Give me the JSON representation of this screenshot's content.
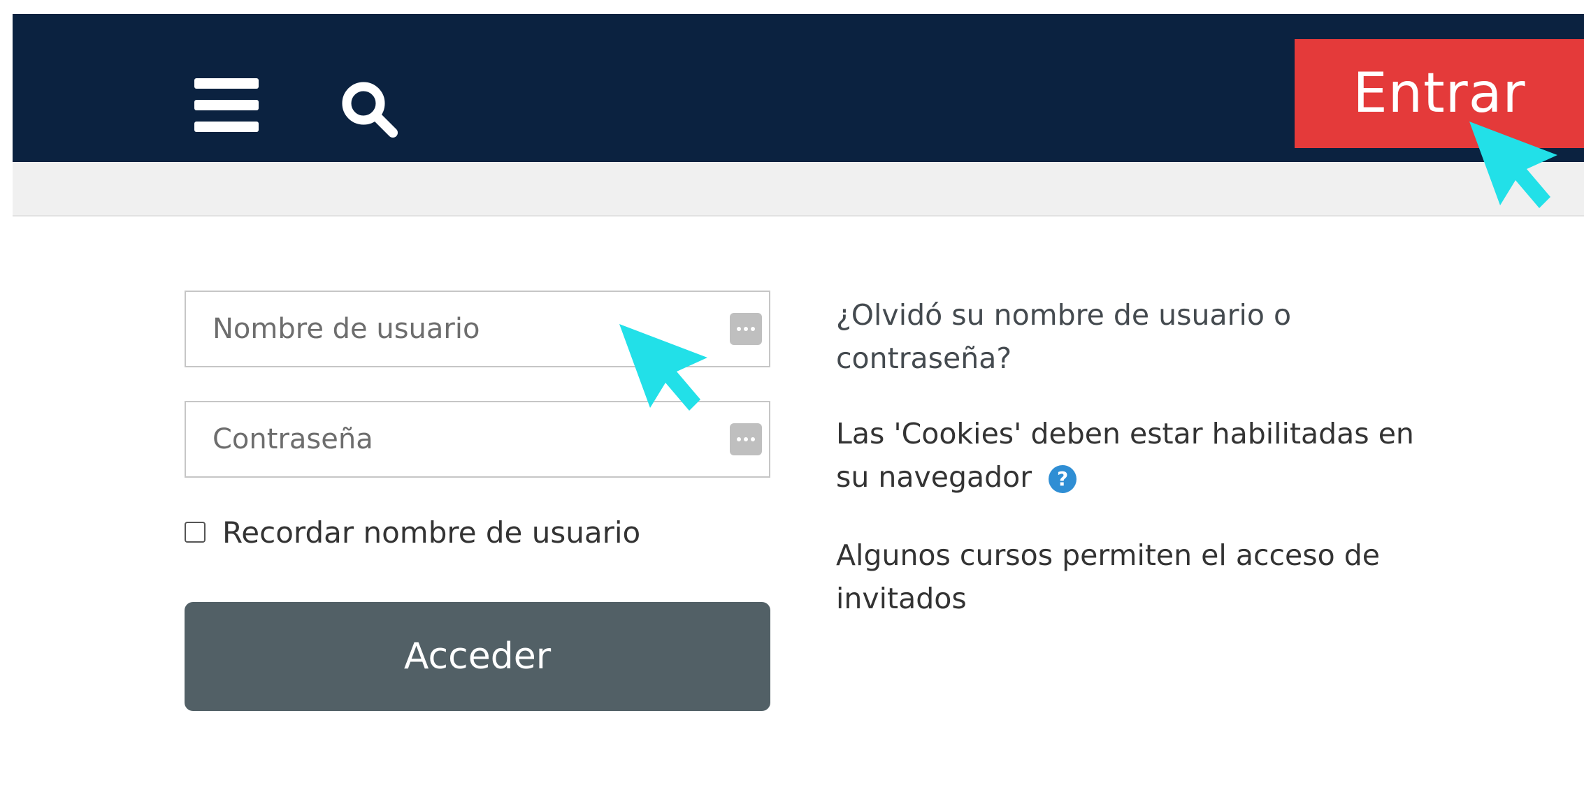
{
  "navbar": {
    "menu_icon": "hamburger-menu-icon",
    "search_icon": "search-icon",
    "login_label": "Entrar",
    "background_color": "#0b2240",
    "login_color": "#e43a3a"
  },
  "login_form": {
    "username_placeholder": "Nombre de usuario",
    "password_placeholder": "Contraseña",
    "remember_label": "Recordar nombre de usuario",
    "submit_label": "Acceder",
    "submit_color": "#526066"
  },
  "info": {
    "forgot_link": "¿Olvidó su nombre de usuario o contraseña?",
    "cookies_notice": "Las 'Cookies' deben estar habilitadas en su navegador",
    "guest_notice": "Algunos cursos permiten el acceso de invitados"
  },
  "annotations": {
    "cursor_color": "#22e0e8"
  }
}
